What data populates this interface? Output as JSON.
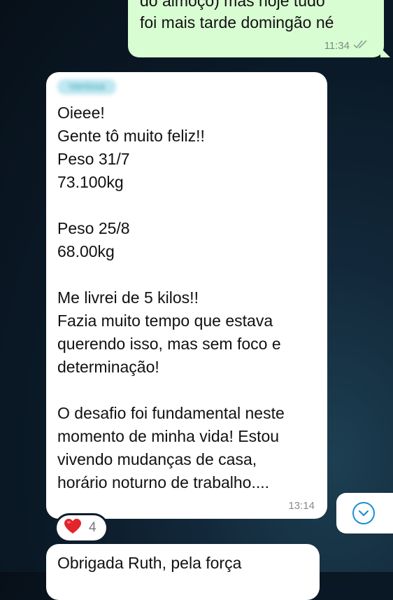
{
  "outgoing_message": {
    "text_lines": "do almoço) mas hoje tudo\nfoi mais tarde domingão né",
    "time": "11:34",
    "status_icon": "double-check-icon"
  },
  "incoming_message": {
    "sender": "Vanissa",
    "text": "Oieee!\nGente tô muito feliz!!\nPeso 31/7\n73.100kg\n\nPeso 25/8\n68.00kg\n\nMe livrei de 5 kilos!!\nFazia muito tempo que estava\nquerendo isso, mas sem foco e\ndeterminação!\n\nO desafio foi fundamental neste\nmomento de minha vida! Estou\nvivendo mudanças de casa,\nhorário noturno de trabalho....",
    "time": "13:14"
  },
  "reaction": {
    "emoji": "❤️",
    "count": "4",
    "icon": "heart-icon"
  },
  "scroll_button": {
    "icon": "chevron-down-icon"
  },
  "next_message": {
    "text": "Obrigada Ruth, pela força"
  },
  "colors": {
    "outgoing_bubble": "#d9fdd3",
    "incoming_bubble": "#ffffff",
    "accent": "#1a8fd6",
    "reaction_heart": "#e3242b"
  }
}
